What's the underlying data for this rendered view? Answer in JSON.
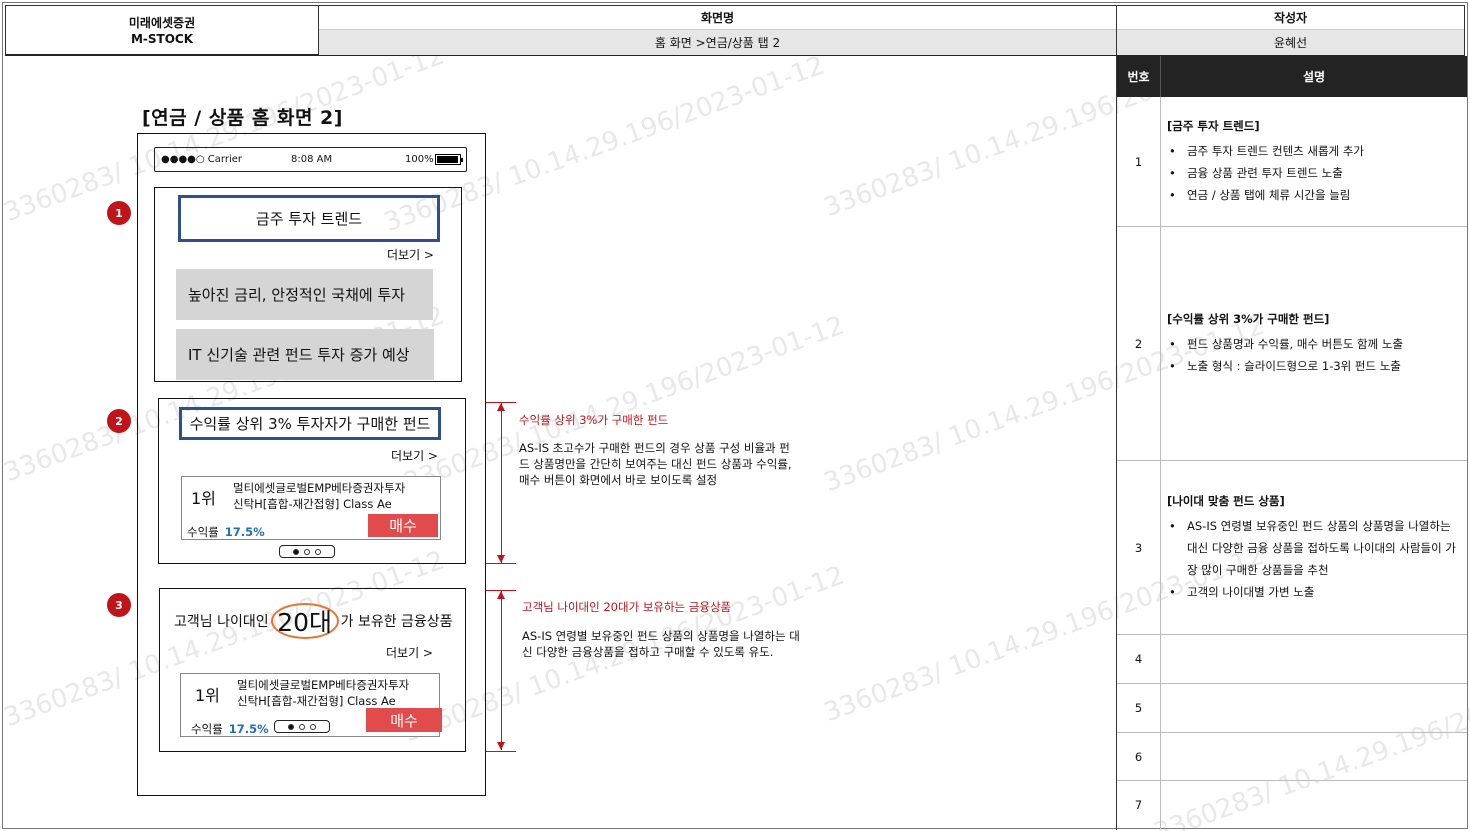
{
  "header": {
    "company": "미래에셋증권",
    "app": "M-STOCK",
    "screen_label": "화면명",
    "screen_path": "홈 화면 >연금/상품 탭 2",
    "author_label": "작성자",
    "author": "윤혜선"
  },
  "canvas_title": "[연금 / 상품 홈 화면 2]",
  "status_bar": {
    "carrier": "●●●●○ Carrier",
    "time": "8:08 AM",
    "battery": "100%"
  },
  "section1": {
    "badge": "1",
    "title": "금주 투자 트렌드",
    "more": "더보기  >",
    "items": [
      "높아진 금리, 안정적인 국채에 투자",
      "IT 신기술 관련 펀드 투자 증가 예상"
    ]
  },
  "section2": {
    "badge": "2",
    "title": "수익률 상위 3% 투자자가 구매한 펀드",
    "more": "더보기  >",
    "card": {
      "rank": "1위",
      "name_line1": "멀티에셋글로벌EMP베타증권자투자",
      "name_line2": "신탁H[흡합-재간접형] Class Ae",
      "yield_label": "수익률",
      "yield_value": "17.5%",
      "buy": "매수"
    }
  },
  "section3": {
    "badge": "3",
    "line_pre": "고객님 나이대인",
    "age": "20대",
    "line_post": "가 보유한 금융상품",
    "more": "더보기  >",
    "card": {
      "rank": "1위",
      "name_line1": "멀티에셋글로벌EMP베타증권자투자",
      "name_line2": "신탁H[흡합-재간접형] Class Ae",
      "yield_label": "수익률",
      "yield_value": "17.5%",
      "buy": "매수"
    }
  },
  "annotations": {
    "a2_title": "수익률 상위 3%가 구매한 펀드",
    "a2_lines": [
      "AS-IS 초고수가 구매한 펀드의 경우 상품 구성 비율과 펀",
      "드 상품명만을 간단히 보여주는 대신 펀드 상품과 수익률,",
      "매수 버튼이 화면에서 바로 보이도록 설정"
    ],
    "a3_title": "고객님 나이대인 20대가 보유하는 금융상품",
    "a3_lines": [
      "AS-IS 연령별 보유중인 펀드 상품의 상품명을 나열하는 대",
      "신 다양한 금융상품을 접하고 구매할 수 있도록 유도."
    ]
  },
  "desc_table": {
    "col_no": "번호",
    "col_desc": "설명",
    "rows": [
      {
        "no": "1",
        "title": "[금주 투자 트렌드]",
        "bullets": [
          "금주 투자 트렌드 컨텐츠 새롭게 추가",
          "금융 상품 관련 투자 트렌드 노출",
          "연금 / 상품 탭에 체류 시간을 늘림"
        ]
      },
      {
        "no": "2",
        "title": "[수익률 상위 3%가 구매한 펀드]",
        "bullets": [
          "펀드 상품명과 수익률, 매수 버튼도 함께 노출",
          "노출 형식 : 슬라이드형으로 1-3위 펀드 노출"
        ]
      },
      {
        "no": "3",
        "title": "[나이대 맞춤 펀드 상품]",
        "bullets": [
          "AS-IS 연령별 보유중인 펀드 상품의 상품명을 나열하는 대신 다양한 금융 상품을 접하도록 나이대의 사람들이 가장 많이 구매한 상품들을 추천",
          "고객의 나이대별 가변 노출"
        ]
      },
      {
        "no": "4",
        "title": "",
        "bullets": []
      },
      {
        "no": "5",
        "title": "",
        "bullets": []
      },
      {
        "no": "6",
        "title": "",
        "bullets": []
      },
      {
        "no": "7",
        "title": "",
        "bullets": []
      }
    ]
  },
  "watermark": "3360283/ 10.14.29.196/2023-01-12",
  "colors": {
    "accent_red": "#c0141b",
    "title_border": "#2f4f8f",
    "buy_button": "#e24b4b",
    "yield_blue": "#1f6fc1",
    "age_ring": "#e8742b"
  }
}
